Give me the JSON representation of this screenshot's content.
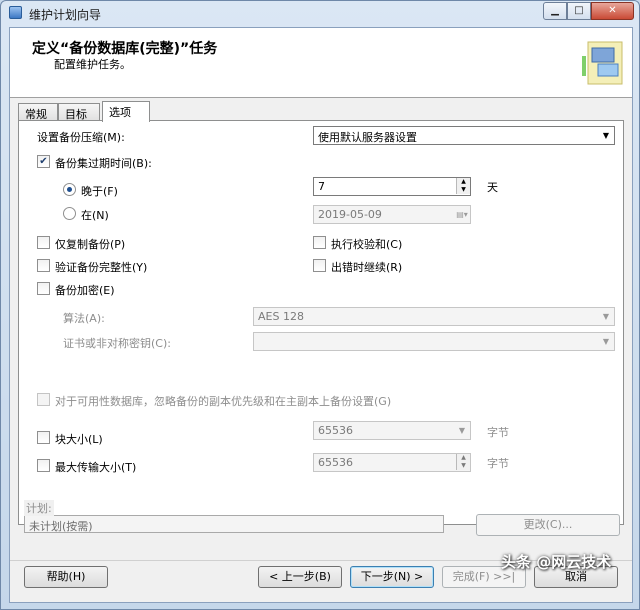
{
  "window": {
    "title": "维护计划向导"
  },
  "header": {
    "title": "定义“备份数据库(完整)”任务",
    "subtitle": "配置维护任务。"
  },
  "tabs": [
    {
      "label": "常规"
    },
    {
      "label": "目标"
    },
    {
      "label": "选项"
    }
  ],
  "options": {
    "compression": {
      "label": "设置备份压缩(M):",
      "value": "使用默认服务器设置"
    },
    "expire": {
      "label": "备份集过期时间(B):",
      "checked": true
    },
    "after": {
      "label": "晚于(F)",
      "value": "7",
      "unit": "天",
      "selected": true
    },
    "on": {
      "label": "在(N)",
      "value": "2019-05-09",
      "selected": false
    },
    "copy_only": {
      "label": "仅复制备份(P)"
    },
    "checksum": {
      "label": "执行校验和(C)"
    },
    "verify": {
      "label": "验证备份完整性(Y)"
    },
    "continue_on_error": {
      "label": "出错时继续(R)"
    },
    "encrypt": {
      "label": "备份加密(E)"
    },
    "algorithm": {
      "label": "算法(A):",
      "value": "AES 128"
    },
    "cert": {
      "label": "证书或非对称密钥(C):",
      "value": ""
    },
    "ag_setting": {
      "label": "对于可用性数据库，忽略备份的副本优先级和在主副本上备份设置(G)"
    },
    "block_size": {
      "label": "块大小(L)",
      "value": "65536",
      "unit": "字节"
    },
    "max_transfer": {
      "label": "最大传输大小(T)",
      "value": "65536",
      "unit": "字节"
    }
  },
  "schedule": {
    "label": "计划:",
    "value": "未计划(按需)",
    "change_label": "更改(C)..."
  },
  "buttons": {
    "help": "帮助(H)",
    "back": "< 上一步(B)",
    "next": "下一步(N) >",
    "finish": "完成(F) >>|",
    "cancel": "取消"
  },
  "watermark": "头条 @网云技术"
}
